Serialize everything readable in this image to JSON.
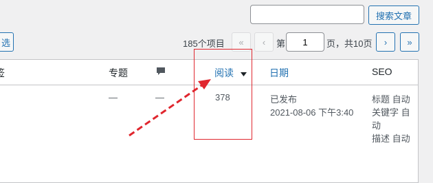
{
  "toolbar": {
    "search_value": "",
    "search_button": "搜索文章",
    "filter_button": "选",
    "item_count": "185个项目",
    "first_page": "«",
    "prev_page": "‹",
    "page_prefix": "第",
    "current_page": "1",
    "page_suffix": "页，共10页",
    "next_page": "›",
    "last_page": "»"
  },
  "table": {
    "headers": {
      "tags": "签",
      "topic": "专题",
      "reads": "阅读",
      "date": "日期",
      "seo": "SEO"
    },
    "row": {
      "topic": "—",
      "comments": "—",
      "reads": "378",
      "status": "已发布",
      "datetime": "2021-08-06 下午3:40",
      "seo_lines": [
        "标题 自动",
        "关键字 自",
        "动",
        "描述 自动"
      ]
    }
  },
  "icons": {
    "comment": "comment-bubble-icon",
    "sort": "sort-desc-icon"
  },
  "colors": {
    "link": "#2271b1",
    "annotation": "#e0262e"
  }
}
